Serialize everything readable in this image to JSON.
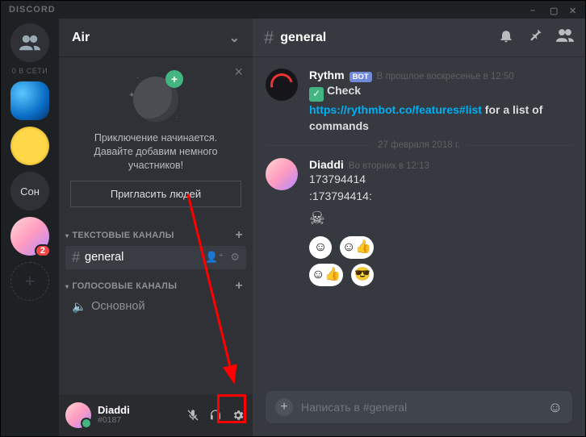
{
  "app_name": "DISCORD",
  "guilds": {
    "online_label": "0 В СЕТИ",
    "text_guild_label": "Сон",
    "badge_count": "2"
  },
  "server": {
    "name": "Air",
    "invite": {
      "line1": "Приключение начинается.",
      "line2": "Давайте добавим немного",
      "line3": "участников!",
      "button": "Пригласить людей",
      "close": "×"
    },
    "cat_text": "ТЕКСТОВЫЕ КАНАЛЫ",
    "cat_voice": "ГОЛОСОВЫЕ КАНАЛЫ",
    "text_channel": "general",
    "voice_channel": "Основной"
  },
  "user": {
    "name": "Diaddi",
    "discriminator": "#0187"
  },
  "chat": {
    "channel_prefix": "#",
    "channel_name": "general",
    "input_placeholder": "Написать в #general",
    "divider_date": "27 февраля 2018 г.",
    "msg1": {
      "author": "Rythm",
      "bot_tag": "BOT",
      "time": "В прошлое воскресенье в 12:50",
      "check_word": "Check",
      "link_url": "https://rythmbot.co/features#list",
      "after_link": " for a list of commands"
    },
    "msg2": {
      "author": "Diaddi",
      "time": "Во вторник в 12:13",
      "line1": "173794414",
      "line2": ":173794414:"
    }
  },
  "icons": {
    "chevron_down": "⌄",
    "plus": "+",
    "hash": "#",
    "speaker": "🔊",
    "mic_mute": "🎤",
    "headset": "🎧",
    "gear": "⚙",
    "bell": "🔔",
    "pin": "📌",
    "members": "👥",
    "emoji": "😀",
    "add_circle": "+",
    "person_add": "👤+",
    "close": "×"
  }
}
